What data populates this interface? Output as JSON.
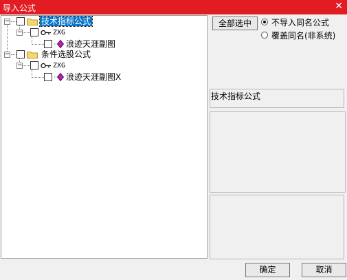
{
  "window": {
    "title": "导入公式",
    "close_glyph": "✕"
  },
  "tree": {
    "expander_collapse": "−",
    "nodes": [
      {
        "label": "技术指标公式"
      },
      {
        "label": "ZXG"
      },
      {
        "label": "浪迹天涯副图"
      },
      {
        "label": "条件选股公式"
      },
      {
        "label": "ZXG"
      },
      {
        "label": "浪迹天涯副图X"
      }
    ]
  },
  "options": {
    "select_all": "全部选中",
    "radio_skip": "不导入同名公式",
    "radio_overwrite": "覆盖同名(非系统)",
    "selected": "radio_skip"
  },
  "info": {
    "text": "技术指标公式"
  },
  "footer": {
    "ok": "确定",
    "cancel": "取消"
  },
  "colors": {
    "titlebar": "#e31b23",
    "selection": "#0a74c9",
    "folder": "#f5d76e",
    "formula_icon": "#b41fb4"
  }
}
